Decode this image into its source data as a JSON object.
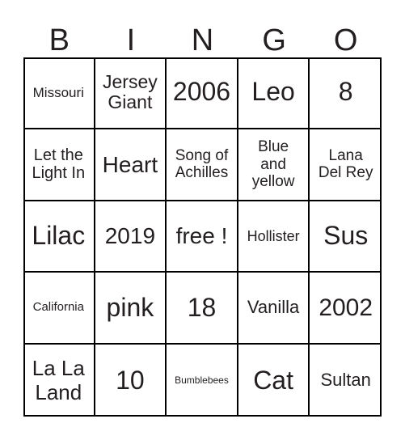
{
  "header": [
    "B",
    "I",
    "N",
    "G",
    "O"
  ],
  "cells": [
    [
      "Missouri",
      "Jersey Giant",
      "2006",
      "Leo",
      "8"
    ],
    [
      "Let the Light In",
      "Heart",
      "Song of Achilles",
      "Blue and yellow",
      "Lana Del Rey"
    ],
    [
      "Lilac",
      "2019",
      "free !",
      "Hollister",
      "Sus"
    ],
    [
      "California",
      "pink",
      "18",
      "Vanilla",
      "2002"
    ],
    [
      "La La Land",
      "10",
      "Bumblebees",
      "Cat",
      "Sultan"
    ]
  ]
}
